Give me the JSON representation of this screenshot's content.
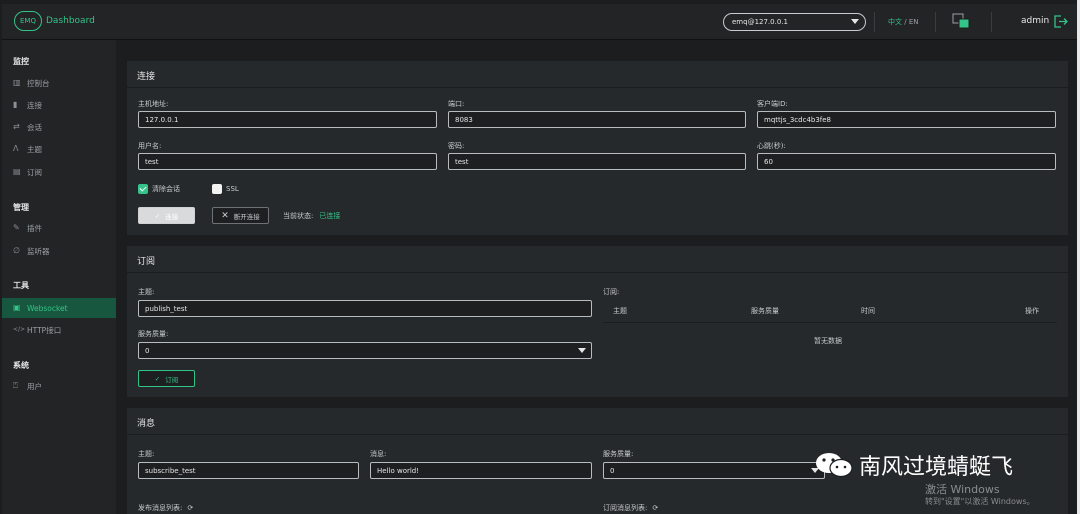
{
  "header": {
    "logo_badge": "EMQ",
    "title": "Dashboard",
    "broker": "emq@127.0.0.1",
    "lang_zh": "中文",
    "lang_sep": " / ",
    "lang_en": "EN",
    "user": "admin"
  },
  "sidebar": {
    "groups": [
      {
        "label": "监控",
        "items": [
          {
            "label": "控制台",
            "icon": "bar-chart-icon"
          },
          {
            "label": "连接",
            "icon": "plug-icon"
          },
          {
            "label": "会话",
            "icon": "swap-icon"
          },
          {
            "label": "主题",
            "icon": "topic-icon"
          },
          {
            "label": "订阅",
            "icon": "list-icon"
          }
        ]
      },
      {
        "label": "管理",
        "items": [
          {
            "label": "插件",
            "icon": "plug-in-icon"
          },
          {
            "label": "监听器",
            "icon": "ear-icon"
          }
        ]
      },
      {
        "label": "工具",
        "items": [
          {
            "label": "Websocket",
            "icon": "websocket-icon",
            "active": true
          },
          {
            "label": "HTTP接口",
            "icon": "code-icon"
          }
        ]
      },
      {
        "label": "系统",
        "items": [
          {
            "label": "用户",
            "icon": "lock-icon"
          }
        ]
      }
    ]
  },
  "connect": {
    "title": "连接",
    "host_label": "主机地址:",
    "host": "127.0.0.1",
    "port_label": "端口:",
    "port": "8083",
    "client_label": "客户端ID:",
    "client": "mqttjs_3cdc4b3fe8",
    "user_label": "用户名:",
    "user": "test",
    "pass_label": "密码:",
    "pass": "test",
    "keepalive_label": "心跳(秒):",
    "keepalive": "60",
    "clean_label": "清除会话",
    "ssl_label": "SSL",
    "connect_btn": "连接",
    "disconnect_btn": "断开连接",
    "status_label": "当前状态:",
    "status": "已连接"
  },
  "subscribe": {
    "title": "订阅",
    "topic_label": "主题:",
    "topic": "publish_test",
    "qos_label": "服务质量:",
    "qos": "0",
    "sub_btn": "订阅",
    "list_label": "订阅:",
    "col_topic": "主题",
    "col_qos": "服务质量",
    "col_time": "时间",
    "col_action": "操作",
    "empty": "暂无数据"
  },
  "message": {
    "title": "消息",
    "topic_label": "主题:",
    "topic": "subscribe_test",
    "msg_label": "消息:",
    "msg": "Hello world!",
    "qos_label": "服务质量:",
    "qos": "0",
    "pub_list": "发布消息列表:",
    "sub_list": "订阅消息列表:"
  },
  "watermark": {
    "brand": "南风过境蜻蜓飞",
    "activate": "激活 Windows",
    "activate_hint": "转到\"设置\"以激活 Windows。"
  },
  "colors": {
    "accent": "#34c388",
    "panel": "#26292b",
    "bg": "#1b1d1f"
  }
}
